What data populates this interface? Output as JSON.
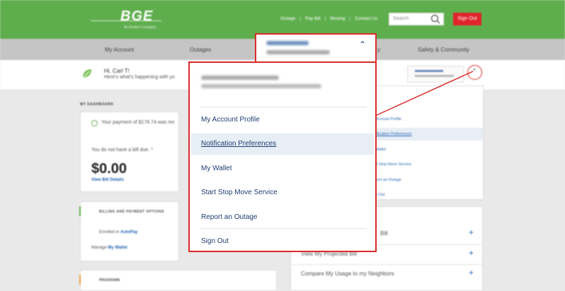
{
  "header": {
    "logo": "BGE",
    "logo_tagline": "An Exelon Company",
    "links": [
      "Outage",
      "Pay Bill",
      "Moving",
      "Contact Us"
    ],
    "search_placeholder": "Search",
    "signout_label": "Sign Out"
  },
  "nav": {
    "items": [
      "My Account",
      "Outages",
      "y",
      "Safety & Community"
    ]
  },
  "greeting": {
    "hello": "Hi, Carl T!",
    "subtext": "Here's what's happening with yo"
  },
  "dashboard": {
    "label": "MY DASHBOARD",
    "payment_msg": "Your payment of $176.74 was rec",
    "no_bill": "You do not have a bill due. *",
    "amount": "$0.00",
    "view_bill": "View Bill Details",
    "billing_heading": "BILLING AND PAYMENT OPTIONS",
    "enrolled_prefix": "Enrolled in",
    "enrolled_link": "AutoPay",
    "manage_prefix": "Manage",
    "manage_link": "My Wallet",
    "programs_heading": "PROGRAMS"
  },
  "right_menu": {
    "items": [
      "Account Profile",
      "tification Preferences",
      "Wallet",
      "rt Stop Move Service",
      "port an Outage",
      "n Out"
    ]
  },
  "list_rows": [
    {
      "label": "Bill"
    },
    {
      "label": "View My Projected Bill"
    },
    {
      "label": "Compare My Usage to my Neighbors"
    }
  ],
  "dropdown": {
    "items": [
      {
        "label": "My Account Profile",
        "active": false
      },
      {
        "label": "Notification Preferences",
        "active": true
      },
      {
        "label": "My Wallet",
        "active": false
      },
      {
        "label": "Start Stop Move Service",
        "active": false
      },
      {
        "label": "Report an Outage",
        "active": false
      },
      {
        "label": "Sign Out",
        "active": false
      }
    ]
  },
  "colors": {
    "brand_green": "#5fae4e",
    "callout_red": "#d92b2b",
    "link_blue": "#1f3e70",
    "signout_red": "#e0242c"
  }
}
